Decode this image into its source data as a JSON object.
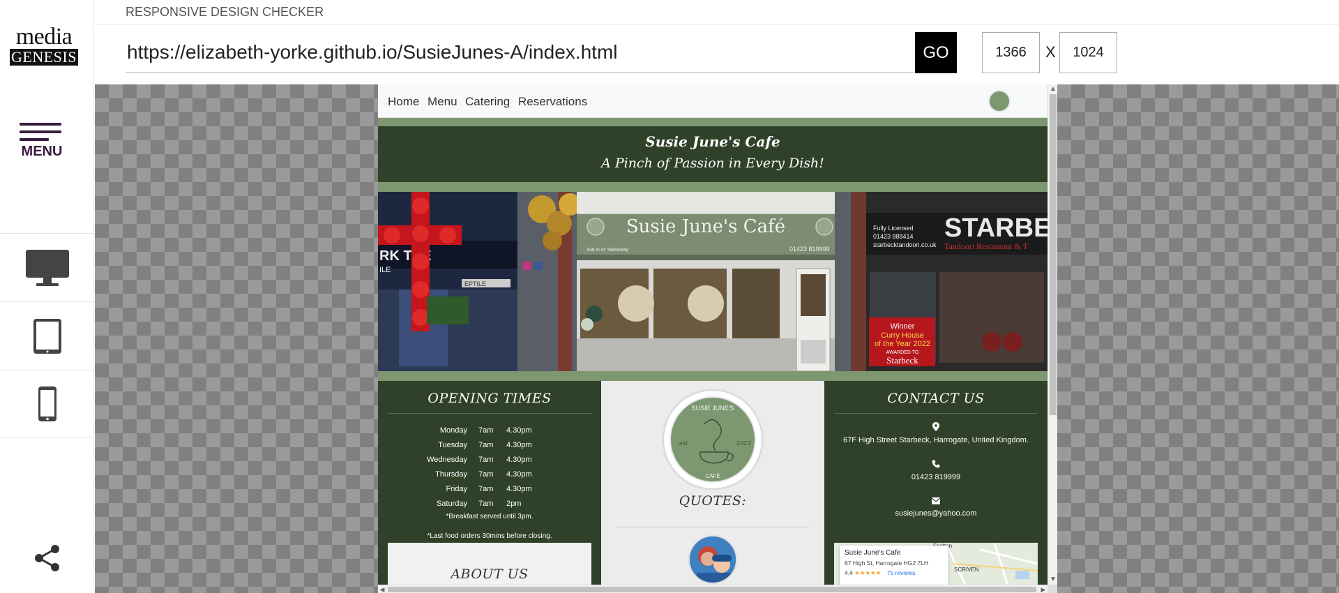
{
  "app": {
    "title": "RESPONSIVE DESIGN CHECKER",
    "logo_line1": "media",
    "logo_line2": "GENESIS",
    "menu_label": "MENU"
  },
  "sidebar": {
    "devices": [
      {
        "name": "desktop",
        "icon": "desktop-icon"
      },
      {
        "name": "tablet",
        "icon": "tablet-icon"
      },
      {
        "name": "mobile",
        "icon": "mobile-icon"
      }
    ],
    "share_icon": "share-icon"
  },
  "toolbar": {
    "url": "https://elizabeth-yorke.github.io/SusieJunes-A/index.html",
    "go_label": "GO",
    "width": "1366",
    "height": "1024",
    "separator": "X"
  },
  "colors": {
    "brand_dark": "#2f4128",
    "brand_sage": "#7d9870",
    "menu_purple": "#3a1a40"
  },
  "site": {
    "nav": [
      "Home",
      "Menu",
      "Catering",
      "Reservations"
    ],
    "header_title": "Susie June's Cafe",
    "header_tagline": "A Pinch of Passion in Every Dish!",
    "photo": {
      "sign": "Susie June's Café",
      "sign_small": "Eat in or Takeaway",
      "sign_phone": "01423 819999",
      "neighbor_licence": "Fully Licensed",
      "neighbor_phone": "01423 888414",
      "neighbor_web": "starbecktandoori.co.uk",
      "neighbor_name": "STARBE",
      "neighbor_sub": "Tandoori Restaurant & T",
      "poster_l1": "Winner",
      "poster_l2": "Curry House",
      "poster_l3": "of the Year 2022",
      "poster_l4": "AWARDED TO",
      "poster_l5": "Starbeck",
      "left_shop": "RK  TRE",
      "left_shop2": "ILE",
      "left_shop3": "EPTILE"
    },
    "opening": {
      "title": "OPENING TIMES",
      "hours": [
        {
          "day": "Monday",
          "open": "7am",
          "close": "4.30pm"
        },
        {
          "day": "Tuesday",
          "open": "7am",
          "close": "4.30pm"
        },
        {
          "day": "Wednesday",
          "open": "7am",
          "close": "4.30pm"
        },
        {
          "day": "Thursday",
          "open": "7am",
          "close": "4.30pm"
        },
        {
          "day": "Friday",
          "open": "7am",
          "close": "4.30pm"
        },
        {
          "day": "Saturday",
          "open": "7am",
          "close": "2pm"
        }
      ],
      "note1": "*Breakfast served until 3pm.",
      "note2": "*Last food orders 30mins before closing."
    },
    "about_title": "ABOUT US",
    "emblem": {
      "top": "SUSIE JUNE'S",
      "bottom": "CAFÉ",
      "left": "est",
      "right": "2023"
    },
    "quotes_title": "QUOTES:",
    "contact": {
      "title": "CONTACT US",
      "address": "67F High Street Starbeck, Harrogate, United Kingdom.",
      "phone": "01423 819999",
      "email": "susiejunes@yahoo.com"
    },
    "map": {
      "place": "Susie June's Cafe",
      "address": "67 High St, Harrogate HG2 7LH",
      "rating": "4.4",
      "stars": "★★★★★",
      "reviews": "75 reviews",
      "label1": "Scotton",
      "label2": "SCRIVEN"
    }
  }
}
